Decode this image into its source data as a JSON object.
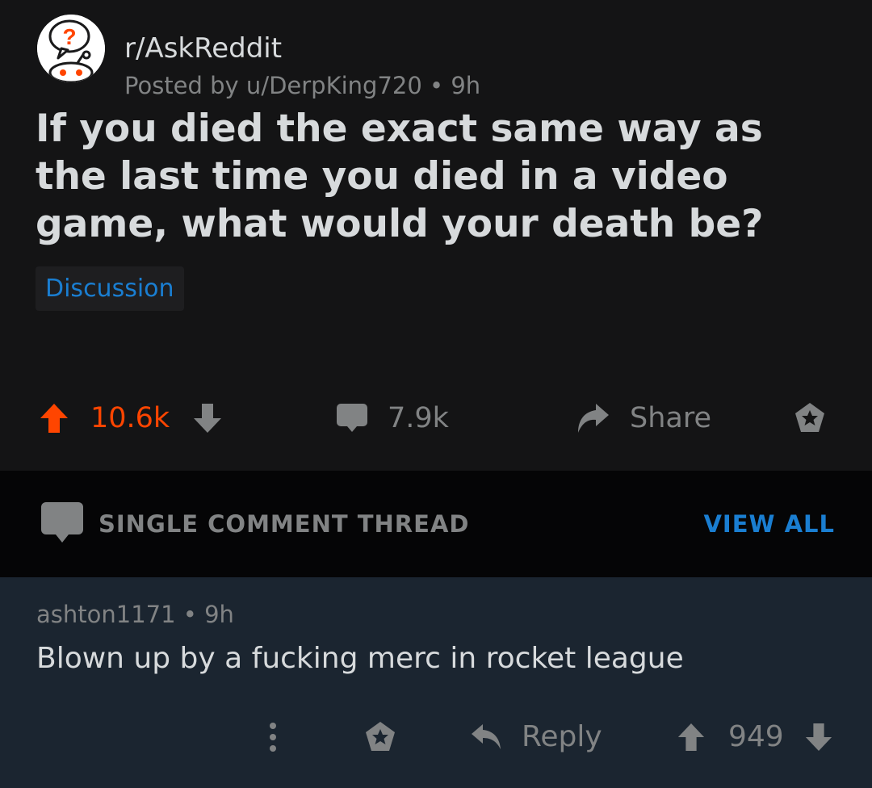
{
  "post": {
    "subreddit": "r/AskReddit",
    "posted_by": "Posted by u/DerpKing720",
    "time": "9h",
    "title": "If you died the exact same way as the last time you died in a video game, what would your death be?",
    "flair": "Discussion",
    "upvotes": "10.6k",
    "comments": "7.9k",
    "share_label": "Share",
    "colors": {
      "upvoted": "#ff4500",
      "muted": "#818384",
      "link": "#1a7ed1"
    }
  },
  "thread": {
    "label": "SINGLE COMMENT THREAD",
    "view_all": "VIEW ALL"
  },
  "comment": {
    "author": "ashton1171",
    "time": "9h",
    "body": "Blown up by a fucking merc in rocket league",
    "reply_label": "Reply",
    "score": "949"
  },
  "icons": [
    "subreddit-avatar-icon",
    "upvote-icon",
    "downvote-icon",
    "comment-icon",
    "share-icon",
    "award-icon",
    "more-icon",
    "reply-icon"
  ]
}
